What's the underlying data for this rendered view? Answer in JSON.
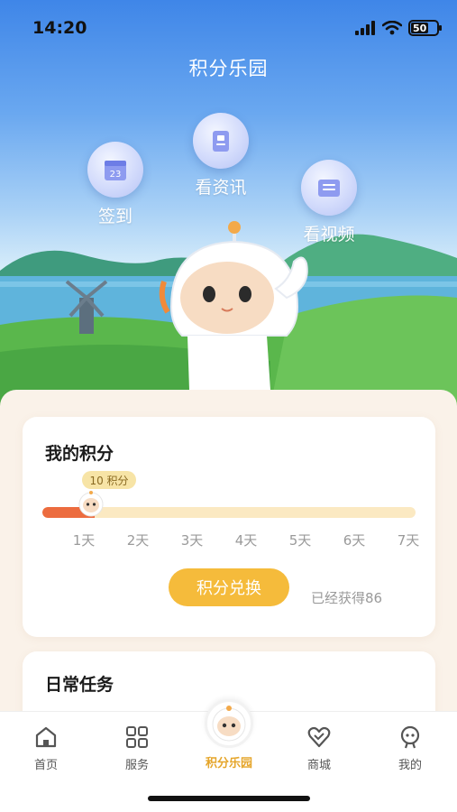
{
  "status_bar": {
    "time": "14:20",
    "battery": "50",
    "icons": [
      "signal-icon",
      "wifi-icon",
      "battery-icon"
    ]
  },
  "header": {
    "title": "积分乐园"
  },
  "actions": [
    {
      "id": "checkin",
      "label": "签到",
      "icon": "calendar-icon",
      "icon_text": "23"
    },
    {
      "id": "news",
      "label": "看资讯",
      "icon": "book-icon"
    },
    {
      "id": "video",
      "label": "看视频",
      "icon": "video-list-icon"
    }
  ],
  "points": {
    "title": "我的积分",
    "badge": "10 积分",
    "progress": 0.14,
    "days": [
      "1天",
      "2天",
      "3天",
      "4天",
      "5天",
      "6天",
      "7天"
    ],
    "exchange_label": "积分兑换",
    "earned_text": "已经获得86"
  },
  "tasks": {
    "title": "日常任务"
  },
  "tabbar": {
    "items": [
      {
        "label": "首页",
        "icon": "home-icon"
      },
      {
        "label": "服务",
        "icon": "grid-icon"
      },
      {
        "label": "积分乐园",
        "icon": "mascot-avatar-icon",
        "active": true
      },
      {
        "label": "商城",
        "icon": "heart-shop-icon"
      },
      {
        "label": "我的",
        "icon": "profile-icon"
      }
    ]
  },
  "colors": {
    "accent": "#f5bb3b",
    "progress": "#ec6c3f",
    "active_tab": "#e5a52a",
    "sky": "#3f86e8"
  }
}
